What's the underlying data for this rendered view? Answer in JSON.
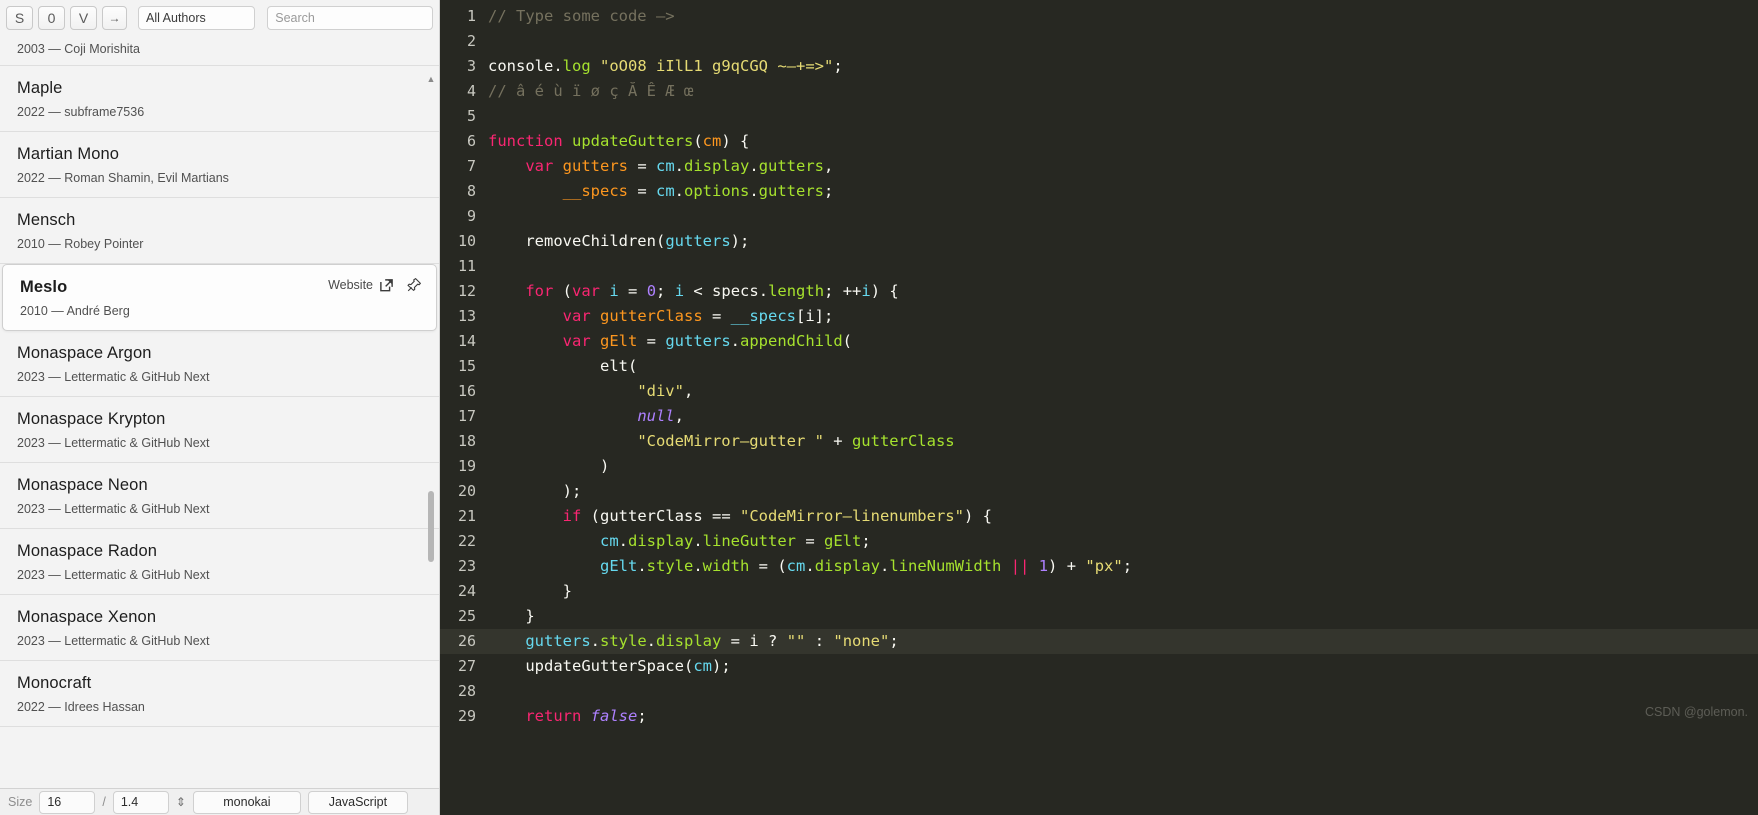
{
  "toolbar": {
    "sample_buttons": [
      {
        "name": "sample-s-button",
        "label": "S"
      },
      {
        "name": "sample-zero-button",
        "label": "0"
      },
      {
        "name": "sample-v-button",
        "label": "V"
      },
      {
        "name": "sample-arrow-button",
        "label": "→"
      }
    ],
    "authors_filter": "All Authors",
    "search_placeholder": "Search",
    "search_value": ""
  },
  "fontlist": {
    "items": [
      {
        "name": "",
        "meta": "2003 — Coji Morishita",
        "partial": true,
        "selected": false
      },
      {
        "name": "Maple",
        "meta": "2022 — subframe7536",
        "selected": false
      },
      {
        "name": "Martian Mono",
        "meta": "2022 — Roman Shamin, Evil Martians",
        "selected": false
      },
      {
        "name": "Mensch",
        "meta": "2010 — Robey Pointer",
        "selected": false
      },
      {
        "name": "Meslo",
        "meta": "2010 — André Berg",
        "selected": true,
        "website_label": "Website"
      },
      {
        "name": "Monaspace Argon",
        "meta": "2023 — Lettermatic & GitHub Next",
        "selected": false
      },
      {
        "name": "Monaspace Krypton",
        "meta": "2023 — Lettermatic & GitHub Next",
        "selected": false
      },
      {
        "name": "Monaspace Neon",
        "meta": "2023 — Lettermatic & GitHub Next",
        "selected": false
      },
      {
        "name": "Monaspace Radon",
        "meta": "2023 — Lettermatic & GitHub Next",
        "selected": false
      },
      {
        "name": "Monaspace Xenon",
        "meta": "2023 — Lettermatic & GitHub Next",
        "selected": false
      },
      {
        "name": "Monocraft",
        "meta": "2022 — Idrees Hassan",
        "selected": false
      }
    ],
    "scroll_up_arrow": "▲",
    "scroll_down_arrow": "▼"
  },
  "statusbar": {
    "size_label": "Size",
    "size_value": "16",
    "separator": "/",
    "lineheight_value": "1.4",
    "lineheight_icon": "⇕",
    "theme_value": "monokai",
    "language_value": "JavaScript"
  },
  "editor": {
    "theme": "monokai",
    "background": "#272822",
    "active_line_background": "#34352d",
    "active_line": 26,
    "watermark": "CSDN @golemon.",
    "lines": [
      {
        "n": 1,
        "tokens": [
          {
            "c": "t-com",
            "t": "// Type some code –>"
          }
        ]
      },
      {
        "n": 2,
        "tokens": []
      },
      {
        "n": 3,
        "tokens": [
          {
            "c": "t-def",
            "t": "console"
          },
          {
            "c": "t-op",
            "t": "."
          },
          {
            "c": "t-fn",
            "t": "log"
          },
          {
            "c": "t-op",
            "t": " "
          },
          {
            "c": "t-str",
            "t": "\"oO08 iIlL1 g9qCGQ ~–+=>\""
          },
          {
            "c": "t-op",
            "t": ";"
          }
        ]
      },
      {
        "n": 4,
        "tokens": [
          {
            "c": "t-com",
            "t": "// â é ù ï ø ç Ă Ê Æ œ"
          }
        ]
      },
      {
        "n": 5,
        "tokens": []
      },
      {
        "n": 6,
        "tokens": [
          {
            "c": "t-kw",
            "t": "function"
          },
          {
            "c": "t-op",
            "t": " "
          },
          {
            "c": "t-fn",
            "t": "updateGutters"
          },
          {
            "c": "t-op",
            "t": "("
          },
          {
            "c": "t-var",
            "t": "cm"
          },
          {
            "c": "t-op",
            "t": ") {"
          }
        ]
      },
      {
        "n": 7,
        "tokens": [
          {
            "c": "t-op",
            "t": "    "
          },
          {
            "c": "t-kw",
            "t": "var"
          },
          {
            "c": "t-op",
            "t": " "
          },
          {
            "c": "t-var",
            "t": "gutters"
          },
          {
            "c": "t-op",
            "t": " = "
          },
          {
            "c": "t-prop",
            "t": "cm"
          },
          {
            "c": "t-op",
            "t": "."
          },
          {
            "c": "t-fn",
            "t": "display"
          },
          {
            "c": "t-op",
            "t": "."
          },
          {
            "c": "t-fn",
            "t": "gutters"
          },
          {
            "c": "t-op",
            "t": ","
          }
        ]
      },
      {
        "n": 8,
        "tokens": [
          {
            "c": "t-op",
            "t": "        "
          },
          {
            "c": "t-var",
            "t": "__specs"
          },
          {
            "c": "t-op",
            "t": " = "
          },
          {
            "c": "t-prop",
            "t": "cm"
          },
          {
            "c": "t-op",
            "t": "."
          },
          {
            "c": "t-fn",
            "t": "options"
          },
          {
            "c": "t-op",
            "t": "."
          },
          {
            "c": "t-fn",
            "t": "gutters"
          },
          {
            "c": "t-op",
            "t": ";"
          }
        ]
      },
      {
        "n": 9,
        "tokens": []
      },
      {
        "n": 10,
        "tokens": [
          {
            "c": "t-op",
            "t": "    "
          },
          {
            "c": "t-def",
            "t": "removeChildren"
          },
          {
            "c": "t-op",
            "t": "("
          },
          {
            "c": "t-prop",
            "t": "gutters"
          },
          {
            "c": "t-op",
            "t": ");"
          }
        ]
      },
      {
        "n": 11,
        "tokens": []
      },
      {
        "n": 12,
        "tokens": [
          {
            "c": "t-op",
            "t": "    "
          },
          {
            "c": "t-kw",
            "t": "for"
          },
          {
            "c": "t-op",
            "t": " ("
          },
          {
            "c": "t-kw",
            "t": "var"
          },
          {
            "c": "t-op",
            "t": " "
          },
          {
            "c": "t-prop",
            "t": "i"
          },
          {
            "c": "t-op",
            "t": " = "
          },
          {
            "c": "t-num",
            "t": "0"
          },
          {
            "c": "t-op",
            "t": "; "
          },
          {
            "c": "t-prop",
            "t": "i"
          },
          {
            "c": "t-op",
            "t": " < "
          },
          {
            "c": "t-def",
            "t": "specs"
          },
          {
            "c": "t-op",
            "t": "."
          },
          {
            "c": "t-fn",
            "t": "length"
          },
          {
            "c": "t-op",
            "t": "; ++"
          },
          {
            "c": "t-prop",
            "t": "i"
          },
          {
            "c": "t-op",
            "t": ") {"
          }
        ]
      },
      {
        "n": 13,
        "tokens": [
          {
            "c": "t-op",
            "t": "        "
          },
          {
            "c": "t-kw",
            "t": "var"
          },
          {
            "c": "t-op",
            "t": " "
          },
          {
            "c": "t-var",
            "t": "gutterClass"
          },
          {
            "c": "t-op",
            "t": " = "
          },
          {
            "c": "t-prop",
            "t": "__specs"
          },
          {
            "c": "t-op",
            "t": "["
          },
          {
            "c": "t-def",
            "t": "i"
          },
          {
            "c": "t-op",
            "t": "];"
          }
        ]
      },
      {
        "n": 14,
        "tokens": [
          {
            "c": "t-op",
            "t": "        "
          },
          {
            "c": "t-kw",
            "t": "var"
          },
          {
            "c": "t-op",
            "t": " "
          },
          {
            "c": "t-var",
            "t": "gElt"
          },
          {
            "c": "t-op",
            "t": " = "
          },
          {
            "c": "t-prop",
            "t": "gutters"
          },
          {
            "c": "t-op",
            "t": "."
          },
          {
            "c": "t-fn",
            "t": "appendChild"
          },
          {
            "c": "t-op",
            "t": "("
          }
        ]
      },
      {
        "n": 15,
        "tokens": [
          {
            "c": "t-op",
            "t": "            "
          },
          {
            "c": "t-def",
            "t": "elt"
          },
          {
            "c": "t-op",
            "t": "("
          }
        ]
      },
      {
        "n": 16,
        "tokens": [
          {
            "c": "t-op",
            "t": "                "
          },
          {
            "c": "t-str",
            "t": "\"div\""
          },
          {
            "c": "t-op",
            "t": ","
          }
        ]
      },
      {
        "n": 17,
        "tokens": [
          {
            "c": "t-op",
            "t": "                "
          },
          {
            "c": "t-atom t-ital",
            "t": "null"
          },
          {
            "c": "t-op",
            "t": ","
          }
        ]
      },
      {
        "n": 18,
        "tokens": [
          {
            "c": "t-op",
            "t": "                "
          },
          {
            "c": "t-str",
            "t": "\"CodeMirror–gutter \""
          },
          {
            "c": "t-op",
            "t": " + "
          },
          {
            "c": "t-fn",
            "t": "gutterClass"
          }
        ]
      },
      {
        "n": 19,
        "tokens": [
          {
            "c": "t-op",
            "t": "            )"
          }
        ]
      },
      {
        "n": 20,
        "tokens": [
          {
            "c": "t-op",
            "t": "        );"
          }
        ]
      },
      {
        "n": 21,
        "tokens": [
          {
            "c": "t-op",
            "t": "        "
          },
          {
            "c": "t-kw",
            "t": "if"
          },
          {
            "c": "t-op",
            "t": " ("
          },
          {
            "c": "t-def",
            "t": "gutterClass"
          },
          {
            "c": "t-op",
            "t": " == "
          },
          {
            "c": "t-str",
            "t": "\"CodeMirror–linenumbers\""
          },
          {
            "c": "t-op",
            "t": ") {"
          }
        ]
      },
      {
        "n": 22,
        "tokens": [
          {
            "c": "t-op",
            "t": "            "
          },
          {
            "c": "t-prop",
            "t": "cm"
          },
          {
            "c": "t-op",
            "t": "."
          },
          {
            "c": "t-fn",
            "t": "display"
          },
          {
            "c": "t-op",
            "t": "."
          },
          {
            "c": "t-fn",
            "t": "lineGutter"
          },
          {
            "c": "t-op",
            "t": " = "
          },
          {
            "c": "t-fn",
            "t": "gElt"
          },
          {
            "c": "t-op",
            "t": ";"
          }
        ]
      },
      {
        "n": 23,
        "tokens": [
          {
            "c": "t-op",
            "t": "            "
          },
          {
            "c": "t-prop",
            "t": "gElt"
          },
          {
            "c": "t-op",
            "t": "."
          },
          {
            "c": "t-fn",
            "t": "style"
          },
          {
            "c": "t-op",
            "t": "."
          },
          {
            "c": "t-fn",
            "t": "width"
          },
          {
            "c": "t-op",
            "t": " = ("
          },
          {
            "c": "t-prop",
            "t": "cm"
          },
          {
            "c": "t-op",
            "t": "."
          },
          {
            "c": "t-fn",
            "t": "display"
          },
          {
            "c": "t-op",
            "t": "."
          },
          {
            "c": "t-fn",
            "t": "lineNumWidth"
          },
          {
            "c": "t-op",
            "t": " "
          },
          {
            "c": "t-kw",
            "t": "||"
          },
          {
            "c": "t-op",
            "t": " "
          },
          {
            "c": "t-num",
            "t": "1"
          },
          {
            "c": "t-op",
            "t": ") + "
          },
          {
            "c": "t-str",
            "t": "\"px\""
          },
          {
            "c": "t-op",
            "t": ";"
          }
        ]
      },
      {
        "n": 24,
        "tokens": [
          {
            "c": "t-op",
            "t": "        }"
          }
        ]
      },
      {
        "n": 25,
        "tokens": [
          {
            "c": "t-op",
            "t": "    }"
          }
        ]
      },
      {
        "n": 26,
        "tokens": [
          {
            "c": "t-op",
            "t": "    "
          },
          {
            "c": "t-prop",
            "t": "gutters"
          },
          {
            "c": "t-op",
            "t": "."
          },
          {
            "c": "t-fn",
            "t": "style"
          },
          {
            "c": "t-op",
            "t": "."
          },
          {
            "c": "t-fn",
            "t": "display"
          },
          {
            "c": "t-op",
            "t": " = "
          },
          {
            "c": "t-def",
            "t": "i"
          },
          {
            "c": "t-op",
            "t": " ? "
          },
          {
            "c": "t-str",
            "t": "\"\""
          },
          {
            "c": "t-op",
            "t": " : "
          },
          {
            "c": "t-str",
            "t": "\"none\""
          },
          {
            "c": "t-op",
            "t": ";"
          }
        ]
      },
      {
        "n": 27,
        "tokens": [
          {
            "c": "t-op",
            "t": "    "
          },
          {
            "c": "t-def",
            "t": "updateGutterSpace"
          },
          {
            "c": "t-op",
            "t": "("
          },
          {
            "c": "t-prop",
            "t": "cm"
          },
          {
            "c": "t-op",
            "t": ");"
          }
        ]
      },
      {
        "n": 28,
        "tokens": []
      },
      {
        "n": 29,
        "tokens": [
          {
            "c": "t-op",
            "t": "    "
          },
          {
            "c": "t-kw",
            "t": "return"
          },
          {
            "c": "t-op",
            "t": " "
          },
          {
            "c": "t-atom t-ital",
            "t": "false"
          },
          {
            "c": "t-op",
            "t": ";"
          }
        ]
      }
    ]
  }
}
